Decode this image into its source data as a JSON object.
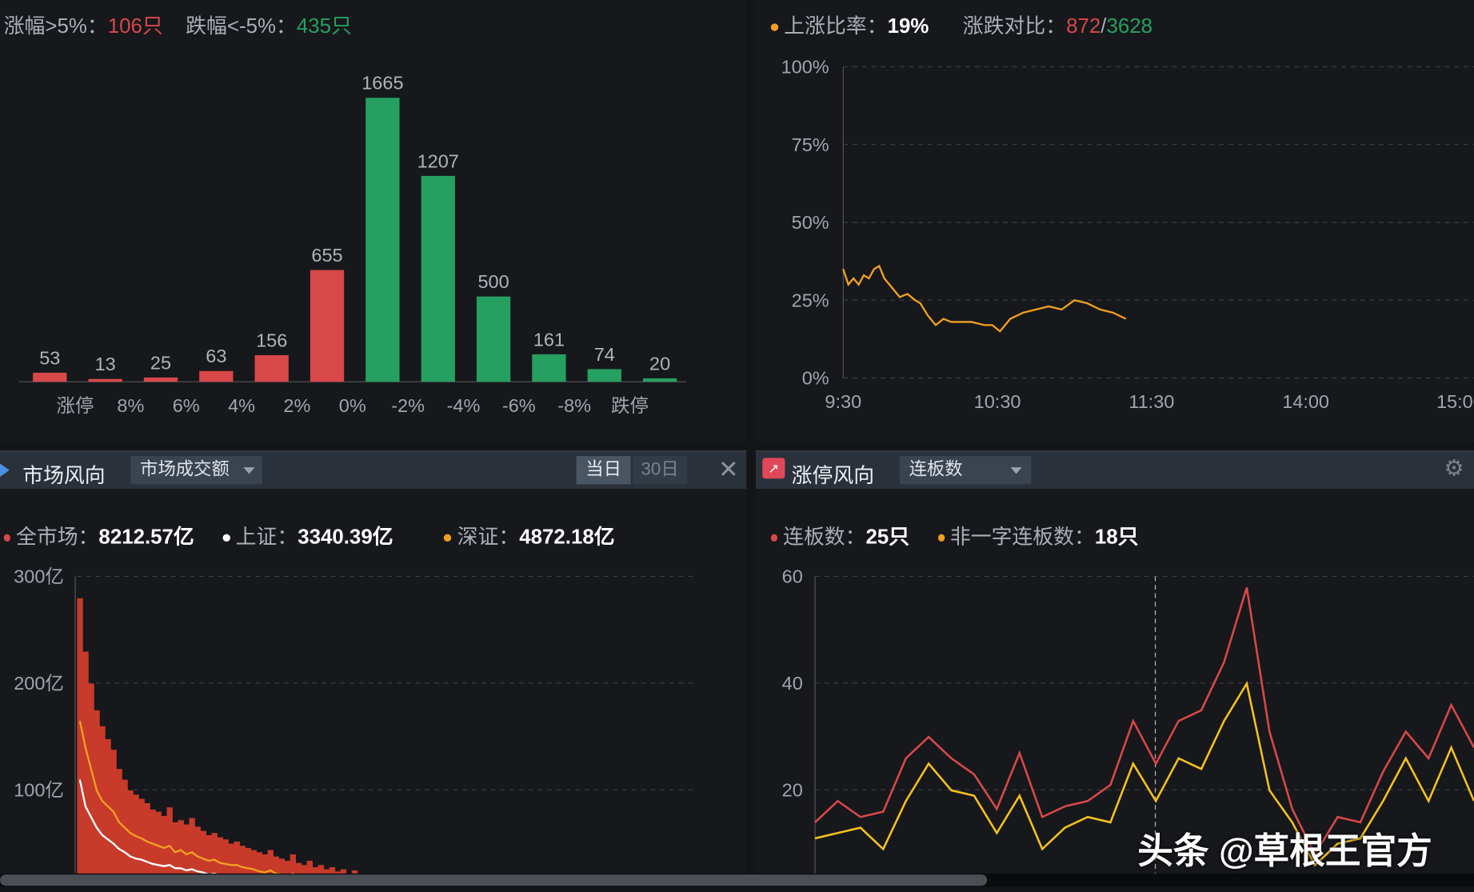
{
  "colors": {
    "up": "#d84848",
    "down": "#26a060",
    "orange": "#f0a020",
    "yellow": "#f5c020",
    "white": "#ffffff"
  },
  "dist": {
    "summary": {
      "up_label": "涨幅>5%：",
      "up_value": "106只",
      "down_label": "跌幅<-5%：",
      "down_value": "435只"
    },
    "chart_data": {
      "type": "bar",
      "values": [
        53,
        13,
        25,
        63,
        156,
        655,
        1665,
        1207,
        500,
        161,
        74,
        20
      ],
      "bar_colors": [
        "up",
        "up",
        "up",
        "up",
        "up",
        "up",
        "down",
        "down",
        "down",
        "down",
        "down",
        "down"
      ],
      "tick_labels": [
        "涨停",
        "8%",
        "6%",
        "4%",
        "2%",
        "0%",
        "-2%",
        "-4%",
        "-6%",
        "-8%",
        "跌停"
      ]
    }
  },
  "ratio": {
    "summary": {
      "label": "上涨比率：",
      "value": "19%",
      "cmp_label": "涨跌对比：",
      "up": "872",
      "sep": "/",
      "down": "3628"
    },
    "chart_data": {
      "type": "line",
      "y_ticks": [
        "100%",
        "75%",
        "50%",
        "25%",
        "0%"
      ],
      "x_ticks": [
        "9:30",
        "10:30",
        "11:30",
        "14:00",
        "15:00"
      ],
      "ylim": [
        0,
        100
      ],
      "x": [
        "9:30",
        "9:32",
        "9:34",
        "9:36",
        "9:38",
        "9:40",
        "9:42",
        "9:44",
        "9:46",
        "9:48",
        "9:50",
        "9:52",
        "9:55",
        "9:58",
        "10:00",
        "10:03",
        "10:06",
        "10:09",
        "10:12",
        "10:15",
        "10:20",
        "10:25",
        "10:28",
        "10:31",
        "10:35",
        "10:40",
        "10:45",
        "10:50",
        "10:55",
        "11:00",
        "11:05",
        "11:10",
        "11:15",
        "11:20"
      ],
      "y": [
        35,
        30,
        32,
        30,
        33,
        32,
        35,
        36,
        32,
        30,
        28,
        26,
        27,
        25,
        24,
        20,
        17,
        19,
        18,
        18,
        18,
        17,
        17,
        15,
        19,
        21,
        22,
        23,
        22,
        25,
        24,
        22,
        21,
        19
      ]
    }
  },
  "market": {
    "title": "市场风向",
    "dropdown": "市场成交额",
    "tab_day": "当日",
    "tab_30": "30日",
    "legend": [
      {
        "label": "全市场：",
        "value": "8212.57亿",
        "color": "up"
      },
      {
        "label": "上证：",
        "value": "3340.39亿",
        "color": "white"
      },
      {
        "label": "深证：",
        "value": "4872.18亿",
        "color": "orange"
      }
    ],
    "chart_data": {
      "type": "bar",
      "y_ticks": [
        "300亿",
        "200亿",
        "100亿"
      ],
      "ylim": [
        0,
        300
      ],
      "unit": "亿",
      "series": [
        {
          "name": "全市场",
          "values": [
            280,
            230,
            200,
            175,
            160,
            148,
            138,
            120,
            110,
            100,
            96,
            92,
            88,
            82,
            80,
            76,
            84,
            70,
            72,
            68,
            74,
            66,
            62,
            58,
            60,
            56,
            54,
            50,
            52,
            48,
            46,
            44,
            42,
            40,
            44,
            38,
            36,
            34,
            40,
            32,
            30,
            34,
            28,
            30,
            26,
            28,
            24,
            26,
            22,
            25,
            20,
            22
          ]
        },
        {
          "name": "深证",
          "values": [
            165,
            140,
            120,
            100,
            90,
            85,
            80,
            70,
            65,
            60,
            57,
            55,
            52,
            50,
            48,
            46,
            48,
            42,
            44,
            40,
            42,
            38,
            36,
            34,
            35,
            32,
            31,
            30,
            30,
            28,
            27,
            26,
            24,
            23,
            25,
            22,
            21,
            20,
            22,
            18,
            17,
            19,
            16,
            16,
            15,
            15,
            14,
            14,
            12,
            13,
            11,
            12
          ]
        },
        {
          "name": "上证",
          "values": [
            110,
            85,
            75,
            65,
            58,
            54,
            50,
            45,
            42,
            38,
            36,
            35,
            33,
            31,
            30,
            29,
            30,
            27,
            27,
            25,
            26,
            24,
            23,
            21,
            22,
            20,
            20,
            18,
            19,
            17,
            17,
            16,
            15,
            14,
            15,
            13,
            13,
            12,
            13,
            11,
            11,
            11,
            10,
            10,
            9,
            9,
            8,
            8,
            8,
            8,
            7,
            7
          ]
        }
      ]
    }
  },
  "limit": {
    "title": "涨停风向",
    "dropdown": "连板数",
    "legend": [
      {
        "label": "连板数：",
        "value": "25只",
        "color": "up"
      },
      {
        "label": "非一字连板数：",
        "value": "18只",
        "color": "orange"
      }
    ],
    "chart_data": {
      "type": "line",
      "y_ticks": [
        "60",
        "40",
        "20"
      ],
      "ylim": [
        0,
        60
      ],
      "series": [
        {
          "name": "连板数",
          "values": [
            14,
            18,
            15,
            16,
            26,
            30,
            26,
            23,
            16.5,
            27,
            15,
            17,
            18,
            21,
            33,
            25,
            33,
            35,
            44,
            58,
            31,
            16.5,
            8,
            15,
            14,
            23.5,
            31,
            26,
            36,
            28
          ]
        },
        {
          "name": "非一字连板数",
          "values": [
            11,
            12,
            13,
            9,
            18,
            25,
            20,
            19,
            12,
            19,
            9,
            13,
            15,
            14,
            25,
            18,
            26,
            24,
            33,
            40,
            20,
            14,
            6,
            10,
            11,
            18,
            26,
            18,
            28,
            18
          ]
        }
      ]
    }
  },
  "watermark": "头条 @草根王官方"
}
